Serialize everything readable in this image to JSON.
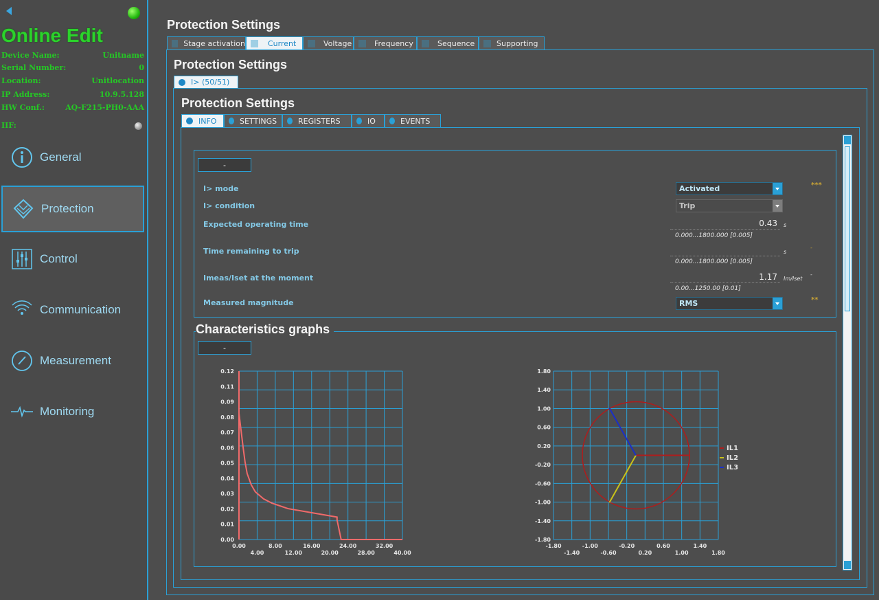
{
  "sidebar": {
    "title": "Online Edit",
    "device_info": [
      {
        "label": "Device Name:",
        "value": "Unitname"
      },
      {
        "label": "Serial Number:",
        "value": "0"
      },
      {
        "label": "Location:",
        "value": "Unitlocation"
      },
      {
        "label": "IP Address:",
        "value": "10.9.5.128"
      },
      {
        "label": "HW Conf.:",
        "value": "AQ-F215-PH0-AAA"
      }
    ],
    "iif_label": "IIF:",
    "nav": [
      {
        "label": "General",
        "icon": "info-circle-icon"
      },
      {
        "label": "Protection",
        "icon": "protection-shield-icon",
        "active": true
      },
      {
        "label": "Control",
        "icon": "control-sliders-icon"
      },
      {
        "label": "Communication",
        "icon": "wifi-signal-icon"
      },
      {
        "label": "Measurement",
        "icon": "gauge-icon"
      },
      {
        "label": "Monitoring",
        "icon": "pulse-wave-icon"
      }
    ]
  },
  "main": {
    "title": "Protection Settings",
    "category_tabs": [
      "Stage activation",
      "Current",
      "Voltage",
      "Frequency",
      "Sequence",
      "Supporting"
    ],
    "selected_category": "Current",
    "sub_title": "Protection Settings",
    "stage_tab": "I> (50/51)",
    "inner_title": "Protection Settings",
    "detail_tabs": [
      "INFO",
      "SETTINGS",
      "REGISTERS",
      "IO",
      "EVENTS"
    ],
    "selected_detail_tab": "INFO",
    "collapse_label": "-",
    "info": {
      "mode_label": "I> mode",
      "mode_value": "Activated",
      "mode_stars": "***",
      "condition_label": "I> condition",
      "condition_value": "Trip",
      "op_time_label": "Expected operating time",
      "op_time_value": "0.43",
      "op_time_unit": "s",
      "op_time_range": "0.000...1800.000 [0.005]",
      "remaining_label": "Time remaining to trip",
      "remaining_value": "",
      "remaining_unit": "s",
      "remaining_range": "0.000...1800.000 [0.005]",
      "remaining_dash": "-",
      "imeas_label": "Imeas/Iset at the moment",
      "imeas_value": "1.17",
      "imeas_unit": "Im/Iset",
      "imeas_range": "0.00...1250.00 [0.01]",
      "imeas_dash": "-",
      "magnitude_label": "Measured magnitude",
      "magnitude_value": "RMS",
      "magnitude_stars": "**"
    },
    "graphs_title": "Characteristics graphs",
    "graphs_collapse_label": "-"
  },
  "colors": {
    "accent": "#2aa0d6",
    "online_green": "#2bd32b",
    "trip_curve": "#f06a6a",
    "il1": "#b01c1c",
    "il2": "#c9c21a",
    "il3": "#1a2fc9"
  },
  "chart_data": [
    {
      "type": "line",
      "title": "",
      "xlabel": "",
      "ylabel": "",
      "xlim": [
        0,
        40
      ],
      "ylim": [
        0,
        0.12
      ],
      "x_ticks": [
        "0.00",
        "4.00",
        "8.00",
        "12.00",
        "16.00",
        "20.00",
        "24.00",
        "28.00",
        "32.00",
        "40.00"
      ],
      "y_ticks": [
        "0.00",
        "0.01",
        "0.02",
        "0.03",
        "0.04",
        "0.05",
        "0.06",
        "0.07",
        "0.08",
        "0.09",
        "0.11",
        "0.12"
      ],
      "grid": true,
      "series": [
        {
          "x": [
            0,
            0.5,
            1,
            1.5,
            2,
            3,
            4,
            6,
            8,
            10,
            12,
            16,
            20,
            24,
            24,
            25,
            40
          ],
          "y": [
            0.09,
            0.078,
            0.066,
            0.055,
            0.047,
            0.039,
            0.034,
            0.029,
            0.026,
            0.024,
            0.022,
            0.02,
            0.018,
            0.016,
            0.014,
            0,
            0
          ]
        }
      ]
    },
    {
      "type": "scatter",
      "title": "",
      "xlim": [
        -1.8,
        1.8
      ],
      "ylim": [
        -1.8,
        1.8
      ],
      "x_ticks": [
        "-1.80",
        "-1.40",
        "-1.00",
        "-0.60",
        "-0.20",
        "0.20",
        "0.60",
        "1.00",
        "1.40",
        "1.80"
      ],
      "y_ticks": [
        "-1.80",
        "-1.40",
        "-1.00",
        "-0.60",
        "-0.20",
        "0.20",
        "0.60",
        "1.00",
        "1.40",
        "1.80"
      ],
      "grid": true,
      "circle_radius": 1.17,
      "series": [
        {
          "name": "IL1",
          "x": [
            0,
            1.17
          ],
          "y": [
            0,
            0
          ]
        },
        {
          "name": "IL2",
          "x": [
            0,
            -0.58
          ],
          "y": [
            0,
            -1.01
          ]
        },
        {
          "name": "IL3",
          "x": [
            0,
            -0.58
          ],
          "y": [
            0,
            1.01
          ]
        }
      ]
    }
  ]
}
